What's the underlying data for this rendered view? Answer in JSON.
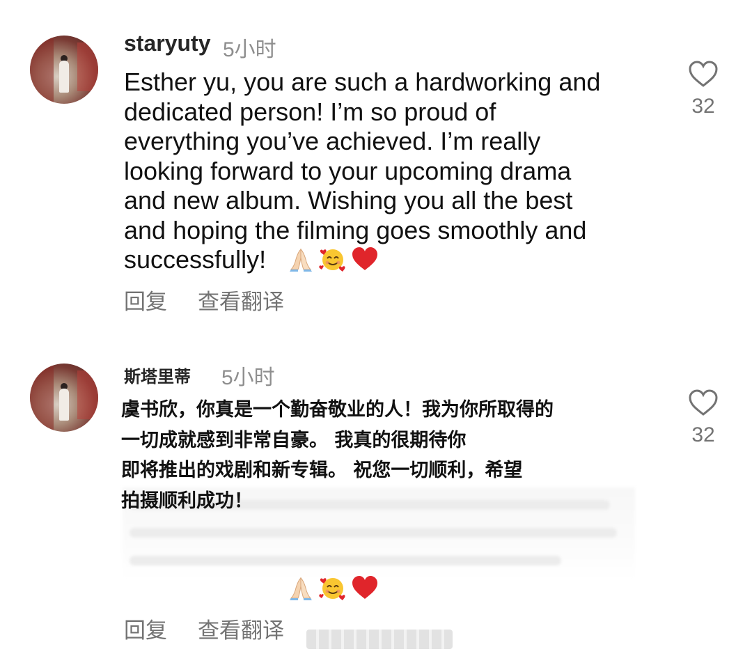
{
  "comments": [
    {
      "username": "staryuty",
      "time": "5小时",
      "text": "Esther yu, you are such a hardworking and\ndedicated person! I’m so proud of\neverything you’ve achieved. I’m really\nlooking forward to your upcoming drama\nand new album. Wishing you all the best\nand hoping the filming goes smoothly and\nsuccessfully!",
      "emojis": [
        "folded-hands",
        "smiling-face-with-hearts",
        "red-heart"
      ],
      "reply_label": "回复",
      "translate_label": "查看翻译",
      "like_count": "32"
    },
    {
      "username": "斯塔里蒂",
      "time": "5小时",
      "text": "虞书欣，你真是一个勤奋敬业的人！我为你所取得的\n一切成就感到非常自豪。 我真的很期待你\n即将推出的戏剧和新专辑。 祝您一切顺利，希望\n拍摄顺利成功！",
      "emojis": [
        "folded-hands",
        "smiling-face-with-hearts",
        "red-heart"
      ],
      "reply_label": "回复",
      "translate_label": "查看翻译",
      "like_count": "32"
    }
  ],
  "colors": {
    "text": "#111111",
    "muted": "#737373",
    "heart_red": "#e0252b"
  }
}
